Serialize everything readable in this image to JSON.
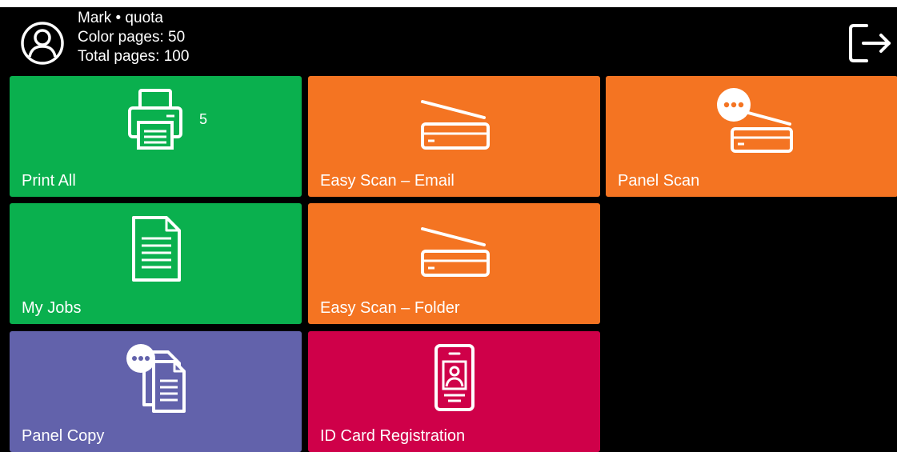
{
  "user": {
    "name_line": "Mark • quota",
    "color_pages": "Color pages: 50",
    "total_pages": "Total pages: 100"
  },
  "header": {
    "avatar_icon": "user-circle-icon",
    "logout_icon": "logout-icon"
  },
  "tiles": [
    {
      "label": "Print All",
      "icon": "printer-icon",
      "badge": "5",
      "color": "#0ab04e"
    },
    {
      "label": "Easy Scan – Email",
      "icon": "scanner-icon",
      "color": "#f47422"
    },
    {
      "label": "Panel Scan",
      "icon": "panel-scanner-icon",
      "color": "#f47422"
    },
    {
      "label": "My Jobs",
      "icon": "document-icon",
      "color": "#0ab04e"
    },
    {
      "label": "Easy Scan – Folder",
      "icon": "scanner-icon",
      "color": "#f47422"
    },
    {
      "label": "Panel Copy",
      "icon": "panel-copy-icon",
      "color": "#6262ab"
    },
    {
      "label": "ID Card Registration",
      "icon": "id-card-icon",
      "color": "#cf0049"
    }
  ]
}
